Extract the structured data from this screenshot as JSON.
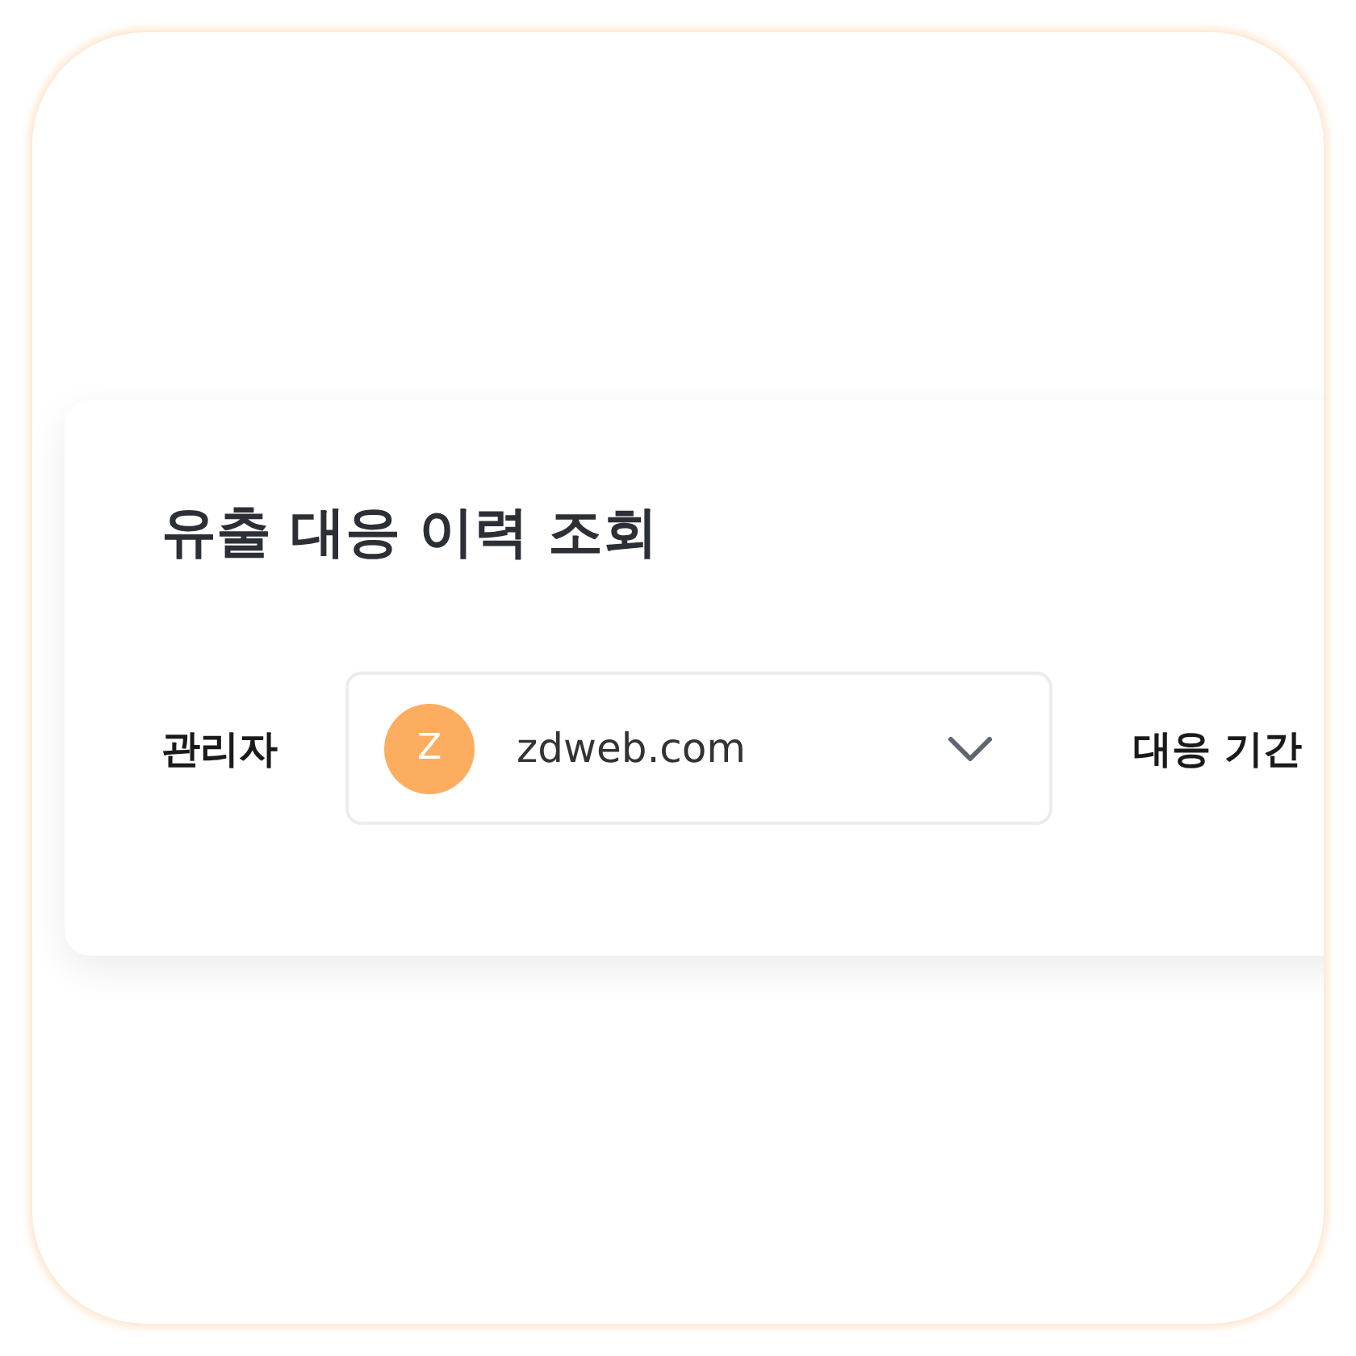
{
  "card": {
    "title": "유출 대응 이력 조회"
  },
  "filters": [
    {
      "kind": "select",
      "label": "관리자",
      "avatar": "Z",
      "value": "zdweb.com"
    },
    {
      "kind": "label",
      "label": "대응 기간"
    }
  ]
}
